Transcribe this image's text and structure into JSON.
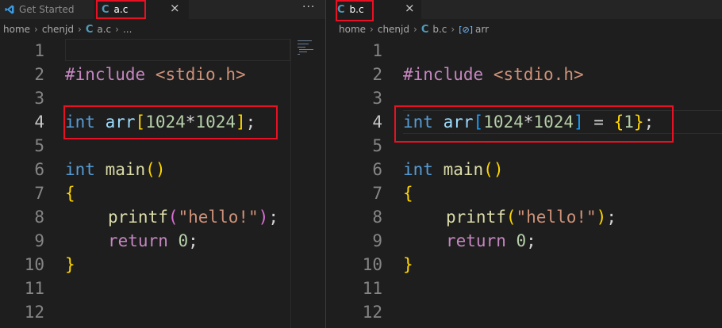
{
  "left": {
    "tabs": [
      {
        "label": "Get Started",
        "icon": "vscode-icon"
      },
      {
        "label": "a.c",
        "icon": "c-file-icon"
      }
    ],
    "more_label": "···",
    "close_label": "×",
    "breadcrumb": [
      "home",
      "chenjd",
      "a.c",
      "..."
    ],
    "line_numbers": [
      "1",
      "2",
      "3",
      "4",
      "5",
      "6",
      "7",
      "8",
      "9",
      "10",
      "11",
      "12"
    ],
    "code": {
      "include_kw": "#include",
      "include_hdr": "<stdio.h>",
      "type_int": "int",
      "arr": "arr",
      "lbracket": "[",
      "n1": "1024",
      "star": "*",
      "n2": "1024",
      "rbracket": "]",
      "semi": ";",
      "main": "main",
      "lparen": "(",
      "rparen": ")",
      "lbrace": "{",
      "printf": "printf",
      "str": "\"hello!\"",
      "return_kw": "return",
      "zero": "0",
      "rbrace": "}"
    }
  },
  "right": {
    "tabs": [
      {
        "label": "b.c",
        "icon": "c-file-icon"
      }
    ],
    "close_label": "×",
    "breadcrumb": [
      "home",
      "chenjd",
      "b.c",
      "arr"
    ],
    "line_numbers": [
      "1",
      "2",
      "3",
      "4",
      "5",
      "6",
      "7",
      "8",
      "9",
      "10",
      "11",
      "12"
    ],
    "code": {
      "include_kw": "#include",
      "include_hdr": "<stdio.h>",
      "type_int": "int",
      "arr": "arr",
      "lbracket": "[",
      "n1": "1024",
      "star": "*",
      "n2": "1024",
      "rbracket": "]",
      "eq": " = ",
      "lbrace_init": "{",
      "one": "1",
      "rbrace_init": "}",
      "semi": ";",
      "main": "main",
      "lparen": "(",
      "rparen": ")",
      "lbrace": "{",
      "printf": "printf",
      "str": "\"hello!\"",
      "return_kw": "return",
      "zero": "0",
      "rbrace": "}"
    }
  },
  "colors": {
    "editor_bg": "#1e1e1e",
    "tabbar_bg": "#252526",
    "highlight_box": "#e81123",
    "keyword": "#569cd6",
    "number": "#b5cea8",
    "string": "#ce9178"
  }
}
